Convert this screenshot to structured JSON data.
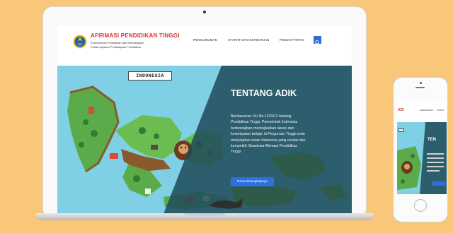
{
  "site": {
    "brand_title": "AFIRMASI PENDIDIKAN TINGGI",
    "brand_sub1": "Kementerian Pendidikan dan Kebudayaan",
    "brand_sub2": "Pusat Layanan Pembiayaan Pendidikan"
  },
  "nav": {
    "items": [
      {
        "label": "PENGUMUMAN"
      },
      {
        "label": "SYARAT DAN KETENTUAN"
      },
      {
        "label": "PENDAFTARAN"
      }
    ]
  },
  "hero": {
    "map_label": "INDONESIA",
    "title": "TENTANG ADIK",
    "body": [
      "Berdasarkan UU No.12/2012 tentang",
      "Pendidikan Tinggi, Pemerintah Indonesia",
      "berkewajiban meningkatkan akses dan",
      "kesempatan belajar di Perguruan Tinggi serta",
      "menyiapkan insan Indonesia yang cerdas dan",
      "kompetitif. Beasiswa Afirmasi Pendidikan",
      "Tinggi"
    ],
    "button_label": "Baca Selengkapnya"
  },
  "phone": {
    "logo": "ADI",
    "nav_items": [
      "PENGUMUMAN",
      "SYARAT"
    ],
    "map_label": "I",
    "hero_title": "TEN"
  },
  "colors": {
    "background": "#f9c779",
    "brand_red": "#e0362a",
    "accent_blue": "#2f6fe0",
    "water": "#7fd0e4",
    "overlay": "#1f4a5a"
  }
}
